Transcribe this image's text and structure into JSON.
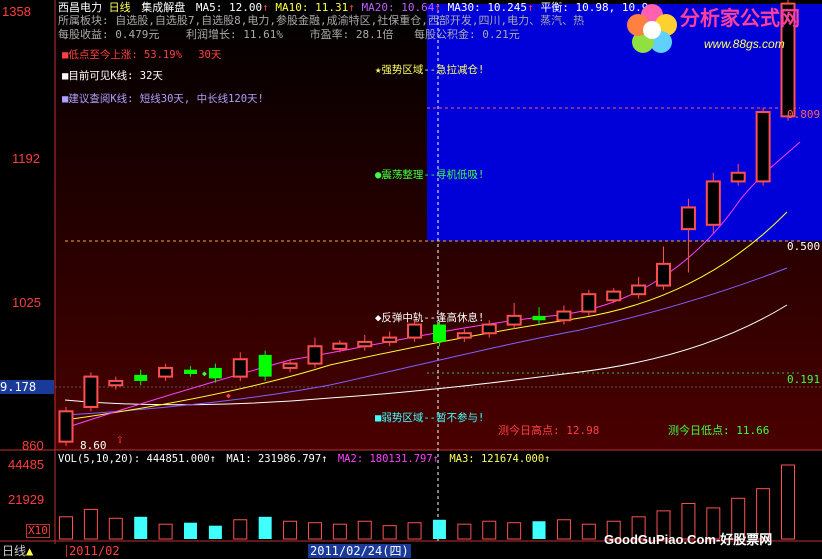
{
  "header": {
    "stock": "西昌电力",
    "period": "日线",
    "indicator": "集成解盘",
    "ma": [
      {
        "label": "MA5: 12.00",
        "color": "#ffffff"
      },
      {
        "label": "MA10: 11.31",
        "color": "#ffff33"
      },
      {
        "label": "MA20: 10.64",
        "color": "#c060ff"
      },
      {
        "label": "MA30: 10.245",
        "color": "#ffffff"
      },
      {
        "label": "平衡: 10.98, 10.9",
        "color": "#ffffff"
      }
    ],
    "sector": "所属板块: 自选股,自选股7,自选股8,电力,参股金融,成渝特区,社保重仓,西部开发,四川,电力、蒸汽、热",
    "eps": "每股收益: 0.479元",
    "profit_growth": "利润增长: 11.61%",
    "pe": "市盈率: 28.1倍",
    "fund": "每股公积金: 0.21元"
  },
  "legend": {
    "rise": "低点至今上涨: 53.19%",
    "rise_days": "30天",
    "visible": "目前可见K线: 32天",
    "suggest": "建议查阅K线: 短线30天, 中长线120天!"
  },
  "zones": {
    "strong": "★强势区域--急拉减仓!",
    "shock": "●震荡整理--寻机低吸!",
    "rebound": "◆反弹中轨--逢高休息!",
    "weak": "■弱势区域--暂不参与!"
  },
  "yaxis": {
    "top": "1358",
    "upper": "1192",
    "mid": "1025",
    "low": "860",
    "cursor": "9.178"
  },
  "vol_axis": {
    "top": "44485",
    "mid": "21929",
    "unit": "X10"
  },
  "fib": {
    "f809": "0.809",
    "f500": "0.500",
    "f191": "0.191"
  },
  "labels": {
    "low_mark": "8.60",
    "high_measure": "测今日高点: 12.98",
    "low_measure": "测今日低点: 11.66"
  },
  "vol_header": {
    "vol": "VOL(5,10,20): 444851.000↑",
    "ma1": "MA1: 231986.797↑",
    "ma2": "MA2: 180131.797↑",
    "ma3": "MA3: 121674.000↑"
  },
  "bottom": {
    "period": "日线",
    "month": "2011/02",
    "date": "2011/02/24",
    "weekday": "四"
  },
  "logo": {
    "name": "分析家公式网",
    "url": "www.88gs.com"
  },
  "watermark": "GoodGuPiao.Com-好股票网",
  "colors": {
    "up": "#ff5050",
    "down": "#00ff00",
    "panel": "#0000d8",
    "bg_gradient_top": "#000000",
    "bg_gradient_bottom": "#4a0000"
  },
  "chart_data": {
    "type": "candlestick",
    "ylim": [
      8.6,
      13.58
    ],
    "candles": [
      {
        "o": 8.65,
        "c": 9.0,
        "h": 9.05,
        "l": 8.6
      },
      {
        "o": 9.05,
        "c": 9.4,
        "h": 9.45,
        "l": 9.0
      },
      {
        "o": 9.3,
        "c": 9.35,
        "h": 9.4,
        "l": 9.25
      },
      {
        "o": 9.42,
        "c": 9.35,
        "h": 9.48,
        "l": 9.3
      },
      {
        "o": 9.4,
        "c": 9.5,
        "h": 9.55,
        "l": 9.35
      },
      {
        "o": 9.48,
        "c": 9.43,
        "h": 9.52,
        "l": 9.4
      },
      {
        "o": 9.5,
        "c": 9.38,
        "h": 9.55,
        "l": 9.33
      },
      {
        "o": 9.4,
        "c": 9.6,
        "h": 9.68,
        "l": 9.35
      },
      {
        "o": 9.65,
        "c": 9.4,
        "h": 9.7,
        "l": 9.35
      },
      {
        "o": 9.5,
        "c": 9.55,
        "h": 9.6,
        "l": 9.45
      },
      {
        "o": 9.55,
        "c": 9.75,
        "h": 9.85,
        "l": 9.5
      },
      {
        "o": 9.72,
        "c": 9.78,
        "h": 9.82,
        "l": 9.68
      },
      {
        "o": 9.75,
        "c": 9.8,
        "h": 9.88,
        "l": 9.7
      },
      {
        "o": 9.8,
        "c": 9.85,
        "h": 9.92,
        "l": 9.75
      },
      {
        "o": 9.85,
        "c": 10.0,
        "h": 10.05,
        "l": 9.8
      },
      {
        "o": 10.0,
        "c": 9.8,
        "h": 10.05,
        "l": 9.75
      },
      {
        "o": 9.85,
        "c": 9.9,
        "h": 9.95,
        "l": 9.8
      },
      {
        "o": 9.9,
        "c": 10.0,
        "h": 10.05,
        "l": 9.85
      },
      {
        "o": 10.0,
        "c": 10.1,
        "h": 10.25,
        "l": 9.95
      },
      {
        "o": 10.1,
        "c": 10.05,
        "h": 10.2,
        "l": 10.0
      },
      {
        "o": 10.05,
        "c": 10.15,
        "h": 10.22,
        "l": 10.0
      },
      {
        "o": 10.15,
        "c": 10.35,
        "h": 10.4,
        "l": 10.1
      },
      {
        "o": 10.28,
        "c": 10.38,
        "h": 10.42,
        "l": 10.25
      },
      {
        "o": 10.35,
        "c": 10.45,
        "h": 10.55,
        "l": 10.3
      },
      {
        "o": 10.45,
        "c": 10.7,
        "h": 10.9,
        "l": 10.4
      },
      {
        "o": 11.1,
        "c": 11.35,
        "h": 11.45,
        "l": 10.6
      },
      {
        "o": 11.15,
        "c": 11.65,
        "h": 11.75,
        "l": 11.05
      },
      {
        "o": 11.65,
        "c": 11.75,
        "h": 11.85,
        "l": 11.6
      },
      {
        "o": 11.65,
        "c": 12.45,
        "h": 12.5,
        "l": 11.6
      },
      {
        "o": 12.4,
        "c": 13.7,
        "h": 13.8,
        "l": 12.35
      }
    ],
    "volume": [
      30,
      40,
      28,
      30,
      20,
      22,
      18,
      26,
      30,
      24,
      22,
      20,
      24,
      18,
      22,
      26,
      20,
      24,
      22,
      24,
      26,
      20,
      24,
      30,
      38,
      48,
      42,
      55,
      68,
      100
    ],
    "vol_ylim": [
      0,
      44485
    ]
  }
}
